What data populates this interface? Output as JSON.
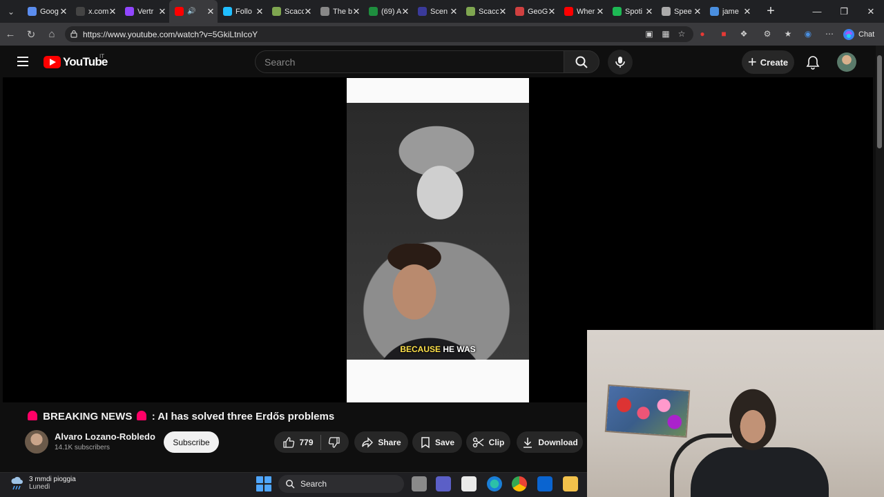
{
  "browser": {
    "tabs": [
      {
        "label": "Goog",
        "icon": "google-docs-icon",
        "color": "#5b8def"
      },
      {
        "label": "x.com",
        "icon": "x-icon",
        "color": "#444444"
      },
      {
        "label": "Vertr",
        "icon": "twitch-icon",
        "color": "#9146ff"
      },
      {
        "label": "",
        "icon": "youtube-icon",
        "color": "#ff0000",
        "active": true,
        "audio": true
      },
      {
        "label": "Follo",
        "icon": "kaggle-icon",
        "color": "#20beff"
      },
      {
        "label": "Scacc",
        "icon": "chess-icon",
        "color": "#7fa650"
      },
      {
        "label": "The b",
        "icon": "generic-icon",
        "color": "#888888"
      },
      {
        "label": "(69) A",
        "icon": "grid-icon",
        "color": "#1e8e3e"
      },
      {
        "label": "Scen",
        "icon": "circle-icon",
        "color": "#3a3a9a"
      },
      {
        "label": "Scacc",
        "icon": "chess-icon",
        "color": "#7fa650"
      },
      {
        "label": "GeoG",
        "icon": "location-icon",
        "color": "#d04040"
      },
      {
        "label": "Wher",
        "icon": "youtube-icon",
        "color": "#ff0000"
      },
      {
        "label": "Spoti",
        "icon": "spotify-icon",
        "color": "#1db954"
      },
      {
        "label": "Spee",
        "icon": "speedtest-icon",
        "color": "#aaaaaa"
      },
      {
        "label": "jame",
        "icon": "search-icon",
        "color": "#4a8fe0"
      }
    ],
    "url": "https://www.youtube.com/watch?v=5GkiLtnIcoY",
    "chat_label": "Chat"
  },
  "youtube": {
    "logo_text": "YouTube",
    "country_code": "IT",
    "search_placeholder": "Search",
    "create_label": "Create",
    "caption_highlight": "BECAUSE",
    "caption_rest": " HE WAS",
    "title_prefix": "BREAKING NEWS",
    "title_suffix": ": AI has solved three Erdős problems",
    "channel_name": "Alvaro Lozano-Robledo",
    "subscriber_count": "14.1K subscribers",
    "subscribe_label": "Subscribe",
    "like_count": "779",
    "share_label": "Share",
    "save_label": "Save",
    "clip_label": "Clip",
    "download_label": "Download"
  },
  "taskbar": {
    "weather_line1": "3 mmdi pioggia",
    "weather_line2": "Lunedì",
    "search_label": "Search"
  },
  "colors": {
    "youtube_red": "#ff0000",
    "caption_yellow": "#ffe24a",
    "background": "#0f0f0f"
  }
}
